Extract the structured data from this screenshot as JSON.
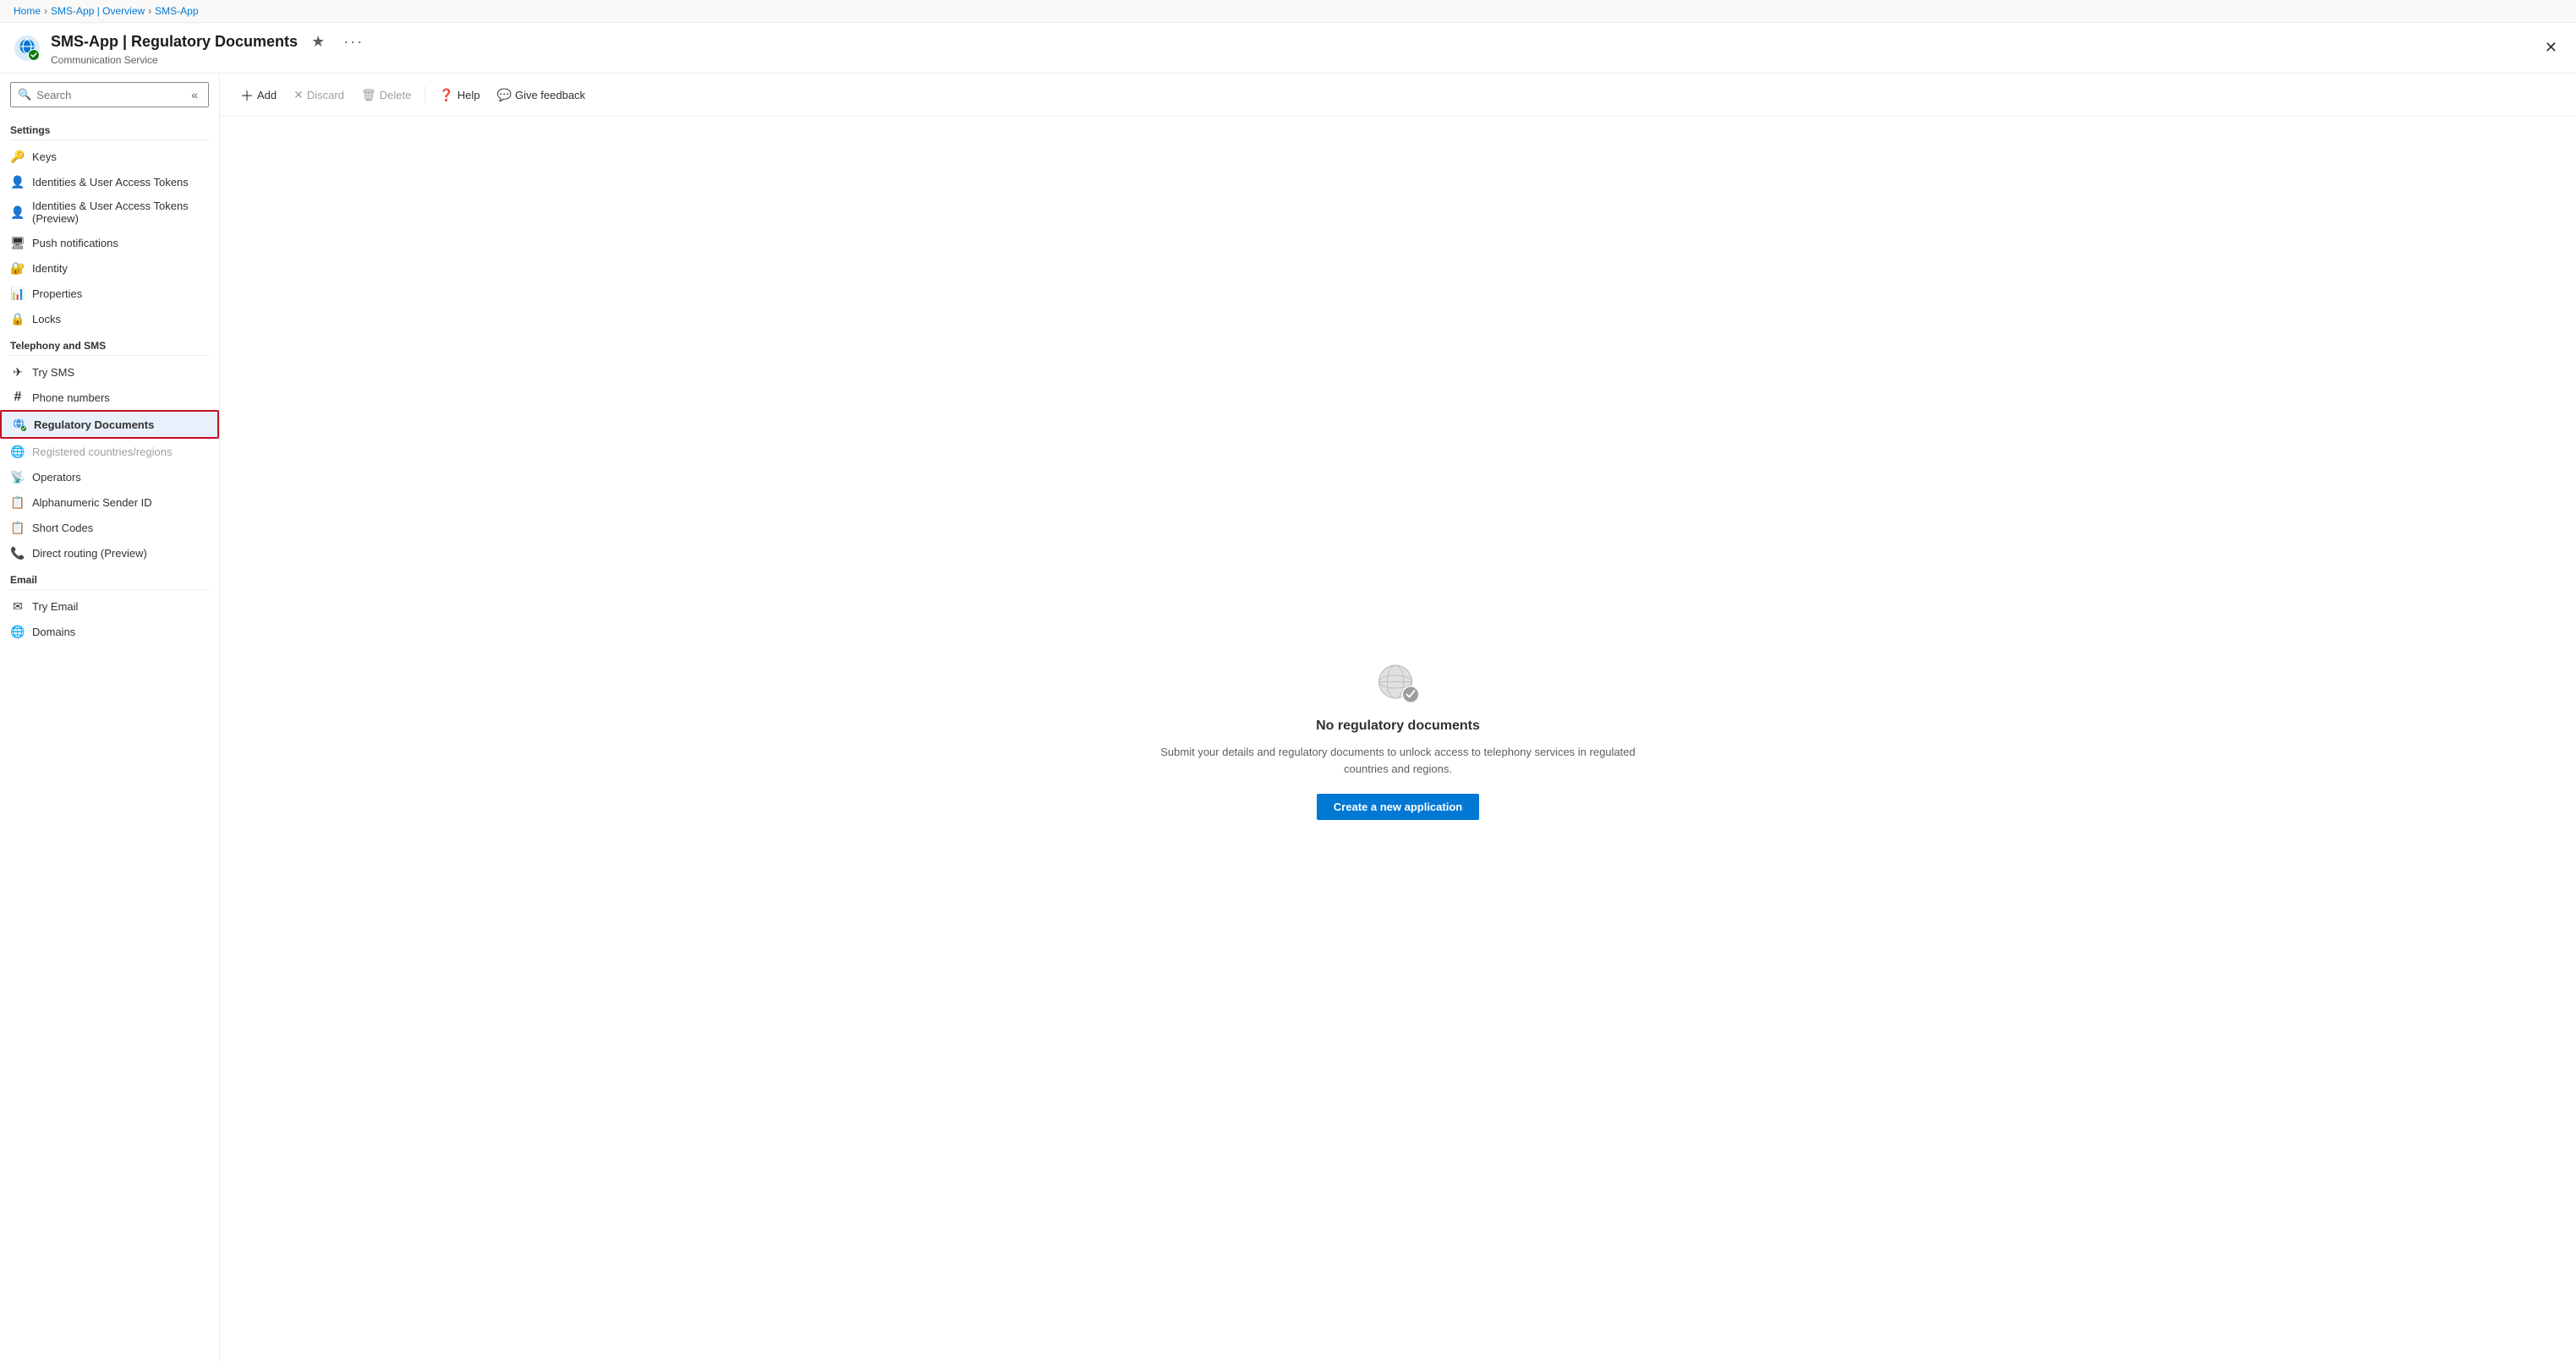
{
  "breadcrumb": {
    "items": [
      {
        "label": "Home",
        "href": "#"
      },
      {
        "label": "SMS-App | Overview",
        "href": "#"
      },
      {
        "label": "SMS-App",
        "href": "#"
      }
    ]
  },
  "header": {
    "title": "SMS-App | Regulatory Documents",
    "subtitle": "Communication Service",
    "star_label": "★",
    "more_label": "···",
    "close_label": "✕"
  },
  "sidebar": {
    "search_placeholder": "Search",
    "collapse_label": "«",
    "sections": [
      {
        "label": "Settings",
        "items": [
          {
            "id": "keys",
            "label": "Keys",
            "icon": "🔑"
          },
          {
            "id": "identities-user-access-tokens",
            "label": "Identities & User Access Tokens",
            "icon": "👤"
          },
          {
            "id": "identities-user-access-tokens-preview",
            "label": "Identities & User Access Tokens (Preview)",
            "icon": "👤"
          },
          {
            "id": "push-notifications",
            "label": "Push notifications",
            "icon": "🖥"
          },
          {
            "id": "identity",
            "label": "Identity",
            "icon": "🔐"
          },
          {
            "id": "properties",
            "label": "Properties",
            "icon": "📊"
          },
          {
            "id": "locks",
            "label": "Locks",
            "icon": "🔒"
          }
        ]
      },
      {
        "label": "Telephony and SMS",
        "items": [
          {
            "id": "try-sms",
            "label": "Try SMS",
            "icon": "✈"
          },
          {
            "id": "phone-numbers",
            "label": "Phone numbers",
            "icon": "#"
          },
          {
            "id": "regulatory-documents",
            "label": "Regulatory Documents",
            "icon": "🌐",
            "active": true
          },
          {
            "id": "registered-countries",
            "label": "Registered countries/regions",
            "icon": "🌐",
            "disabled": true
          },
          {
            "id": "operators",
            "label": "Operators",
            "icon": "📡"
          },
          {
            "id": "alphanumeric-sender-id",
            "label": "Alphanumeric Sender ID",
            "icon": "📋"
          },
          {
            "id": "short-codes",
            "label": "Short Codes",
            "icon": "📋"
          },
          {
            "id": "direct-routing",
            "label": "Direct routing (Preview)",
            "icon": "📞"
          }
        ]
      },
      {
        "label": "Email",
        "items": [
          {
            "id": "try-email",
            "label": "Try Email",
            "icon": "✉"
          },
          {
            "id": "domains",
            "label": "Domains",
            "icon": "🌐"
          }
        ]
      }
    ]
  },
  "toolbar": {
    "add_label": "Add",
    "discard_label": "Discard",
    "delete_label": "Delete",
    "help_label": "Help",
    "give_feedback_label": "Give feedback"
  },
  "empty_state": {
    "title": "No regulatory documents",
    "description": "Submit your details and regulatory documents to unlock access to telephony services in regulated countries and regions.",
    "create_button": "Create a new application"
  }
}
